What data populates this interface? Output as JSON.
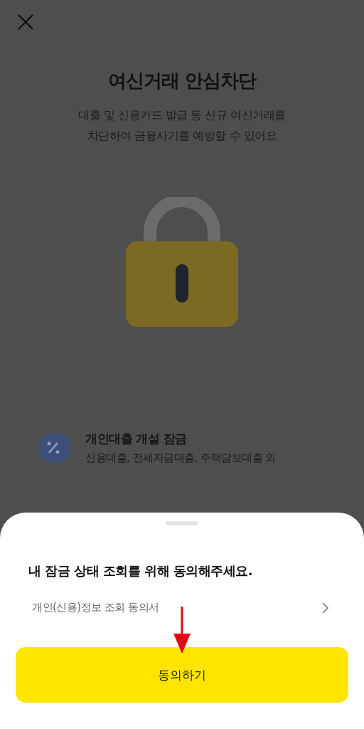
{
  "header": {
    "title": "여신거래 안심차단",
    "subtitle_lines": [
      "대출 및 신용카드 발급 등 신규 여신거래를",
      "차단하여 금융사기를 예방할 수 있어요"
    ]
  },
  "lock_items": [
    {
      "title": "개인대출 개설 잠금",
      "description": "신용대출, 전세자금대출, 주택담보대출 외"
    }
  ],
  "sheet": {
    "heading": "내 잠금 상태 조회를 위해 동의해주세요.",
    "consent_link": "개인(신용)정보 조회 동의서",
    "button": "동의하기"
  }
}
